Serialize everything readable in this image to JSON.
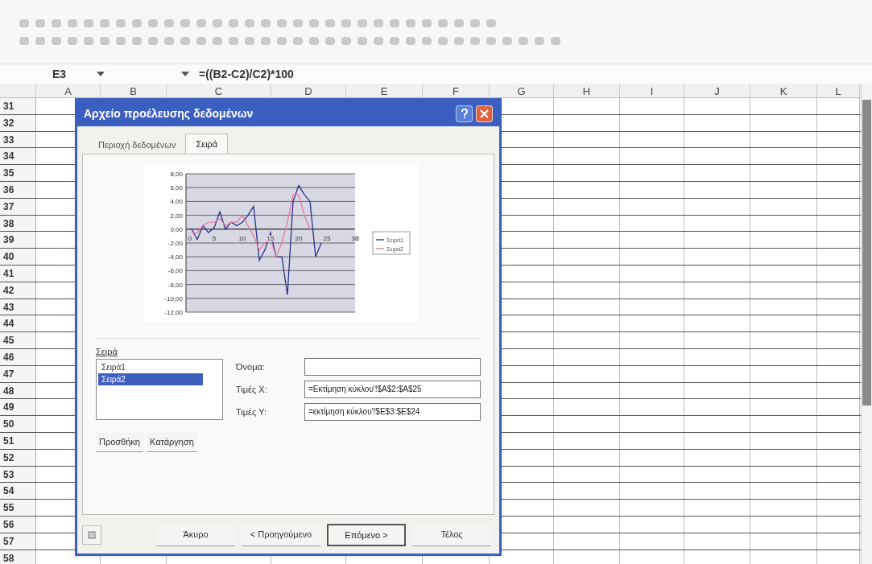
{
  "formula_bar": {
    "name_box": "E3",
    "formula": "=((B2-C2)/C2)*100"
  },
  "columns": [
    "A",
    "B",
    "C",
    "D",
    "E",
    "F",
    "G",
    "H",
    "I",
    "J",
    "K",
    "L"
  ],
  "rows": [
    "31",
    "32",
    "33",
    "34",
    "35",
    "36",
    "37",
    "38",
    "39",
    "40",
    "41",
    "42",
    "43",
    "44",
    "45",
    "46",
    "47",
    "48",
    "49",
    "50",
    "51",
    "52",
    "53",
    "54",
    "55",
    "56",
    "57",
    "58"
  ],
  "dialog": {
    "title": "Αρχείο προέλευσης δεδομένων",
    "tabs": [
      {
        "label": "Περιοχή δεδομένων",
        "selected": false
      },
      {
        "label": "Σειρά",
        "selected": true
      }
    ],
    "chart_data": {
      "type": "line",
      "x": [
        1,
        2,
        3,
        4,
        5,
        6,
        7,
        8,
        9,
        10,
        11,
        12,
        13,
        14,
        15,
        16,
        17,
        18,
        19,
        20,
        21,
        22,
        23,
        24
      ],
      "series": [
        {
          "name": "Σειρά1",
          "color": "#2a2f86",
          "values": [
            0,
            -1.5,
            0.5,
            -0.5,
            0.2,
            2.5,
            0,
            1,
            0.5,
            1,
            2,
            3.3,
            -4.5,
            -3,
            -0.5,
            -4,
            -4,
            -9.5,
            4,
            6.3,
            5,
            4,
            -4,
            -2
          ]
        },
        {
          "name": "Σειρά2",
          "color": "#e27aa8",
          "values": [
            -0.5,
            -0.5,
            0.5,
            1,
            1,
            1.5,
            0.5,
            1,
            1,
            2,
            0.5,
            -1,
            -3,
            -2,
            -1.5,
            -4,
            -2,
            1,
            5,
            5,
            2,
            0,
            null,
            null
          ]
        }
      ],
      "xlim": [
        0,
        30
      ],
      "ylim": [
        -12,
        8
      ],
      "grid": true,
      "legend": true,
      "xticks": [
        {
          "value": 0,
          "label": "0"
        },
        {
          "value": 5,
          "label": "5"
        },
        {
          "value": 10,
          "label": "10"
        },
        {
          "value": 15,
          "label": "15"
        },
        {
          "value": 20,
          "label": "20"
        },
        {
          "value": 25,
          "label": "25"
        },
        {
          "value": 30,
          "label": "30"
        }
      ],
      "yticks": [
        {
          "value": 8,
          "label": "8,00"
        },
        {
          "value": 6,
          "label": "6,00"
        },
        {
          "value": 4,
          "label": "4,00"
        },
        {
          "value": 2,
          "label": "2,00"
        },
        {
          "value": 0,
          "label": "0,00"
        },
        {
          "value": -2,
          "label": "-2,00"
        },
        {
          "value": -4,
          "label": "-4,00"
        },
        {
          "value": -6,
          "label": "-6,00"
        },
        {
          "value": -8,
          "label": "-8,00"
        },
        {
          "value": -10,
          "label": "-10,00"
        },
        {
          "value": -12,
          "label": "-12,00"
        }
      ]
    },
    "series_label": "Σειρά",
    "series_list": [
      {
        "label": "Σειρά1",
        "selected": false
      },
      {
        "label": "Σειρά2",
        "selected": true
      }
    ],
    "fields": [
      {
        "label": "Όνομα:"
      },
      {
        "label": "Τιμές X:",
        "value": "=Εκτίμηση κύκλου'!$A$2:$A$25"
      },
      {
        "label": "Τιμές Y:",
        "value": "=εκτίμηση κύκλου'!$E$3:$E$24"
      }
    ],
    "list_buttons": [
      "Προσθήκη",
      "Κατάργηση"
    ],
    "footer_buttons": [
      {
        "label": "Άκυρο",
        "default": false
      },
      {
        "label": "< Προηγούμενο",
        "default": false
      },
      {
        "label": "Επόμενο >",
        "default": true
      },
      {
        "label": "Τέλος",
        "default": false
      }
    ]
  }
}
